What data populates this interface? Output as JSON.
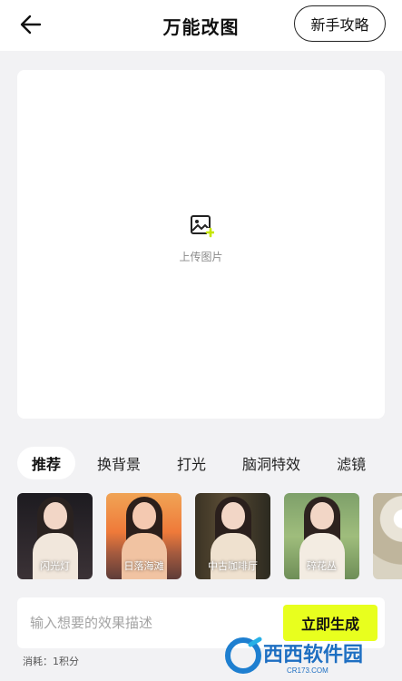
{
  "header": {
    "title": "万能改图",
    "guide_label": "新手攻略"
  },
  "upload": {
    "label": "上传图片"
  },
  "tabs": [
    {
      "label": "推荐",
      "active": true
    },
    {
      "label": "换背景",
      "active": false
    },
    {
      "label": "打光",
      "active": false
    },
    {
      "label": "脑洞特效",
      "active": false
    },
    {
      "label": "滤镜",
      "active": false
    }
  ],
  "styles": [
    {
      "label": "闪光灯"
    },
    {
      "label": "日落海滩"
    },
    {
      "label": "中古咖啡厅"
    },
    {
      "label": "碎花丛"
    },
    {
      "label": ""
    }
  ],
  "prompt": {
    "placeholder": "输入想要的效果描述",
    "value": "",
    "generate_label": "立即生成"
  },
  "cost_text": "消耗：1积分",
  "watermark": {
    "text": "西西软件园",
    "sub": "CR173.COM"
  },
  "colors": {
    "accent": "#e8ff1e",
    "icon_plus": "#c6e600"
  }
}
